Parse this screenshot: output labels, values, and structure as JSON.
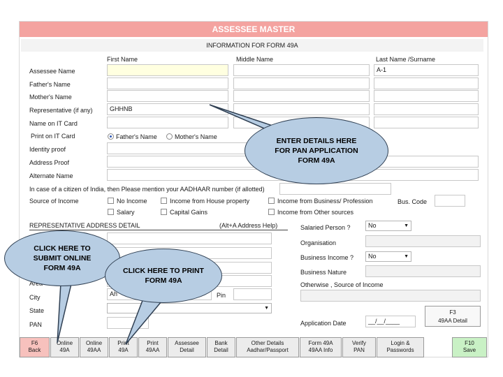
{
  "window": {
    "title": "ASSESSEE MASTER",
    "subtitle": "INFORMATION FOR FORM 49A"
  },
  "name_columns": {
    "first": "First Name",
    "middle": "Middle Name",
    "last": "Last Name /Surname"
  },
  "rows": {
    "assessee_name": {
      "label": "Assessee Name",
      "first": "",
      "middle": "",
      "last": "A-1"
    },
    "fathers_name": {
      "label": "Father's Name"
    },
    "mothers_name": {
      "label": "Mother's Name"
    },
    "representative": {
      "label": "Representative (if any)",
      "first": "GHHNB"
    },
    "name_on_card": {
      "label": "Name on IT Card"
    },
    "print_on_card": {
      "label": "Print on IT Card",
      "option1": "Father's Name",
      "option2": "Mother's Name",
      "selected": "Father's Name"
    },
    "identity_proof": {
      "label": "Identity proof"
    },
    "address_proof": {
      "label": "Address Proof"
    },
    "alternate_name": {
      "label": "Alternate Name"
    }
  },
  "aadhaar_note": "In case of a citizen of India, then Please mention your AADHAAR number (if allotted)",
  "source_income": {
    "label": "Source of Income",
    "options": [
      "No Income",
      "Income from House property",
      "Income from Business/ Profession",
      "Salary",
      "Capital Gains",
      "Income from Other sources"
    ],
    "bus_code_label": "Bus. Code"
  },
  "rep_address": {
    "heading": "REPRESENTATIVE ADDRESS DETAIL",
    "help": "(Alt+A  Address Help)",
    "area_label": "Area",
    "city_label": "City",
    "city_value": "Ah",
    "pin_label": "Pin",
    "state_label": "State",
    "pan_label": "PAN"
  },
  "right_panel": {
    "salaried_label": "Salaried Person ?",
    "salaried_value": "No",
    "organisation_label": "Organisation",
    "business_income_label": "Business Income ?",
    "business_income_value": "No",
    "business_nature_label": "Business Nature",
    "otherwise_label": "Otherwise , Source of Income",
    "application_date_label": "Application Date",
    "application_date_value": "__/__/____",
    "detail_btn_line1": "F3",
    "detail_btn_line2": "49AA Detail"
  },
  "buttons": [
    {
      "line1": "F6",
      "line2": "Back"
    },
    {
      "line1": "Online",
      "line2": "49A"
    },
    {
      "line1": "Online",
      "line2": "49AA"
    },
    {
      "line1": "Print",
      "line2": "49A"
    },
    {
      "line1": "Print",
      "line2": "49AA"
    },
    {
      "line1": "Assessee",
      "line2": "Detail"
    },
    {
      "line1": "Bank",
      "line2": "Detail"
    },
    {
      "line1": "Other Details",
      "line2": "Aadhar/Passport"
    },
    {
      "line1": "Form 49A",
      "line2": "49AA Info"
    },
    {
      "line1": "Verify",
      "line2": "PAN"
    },
    {
      "line1": "Login &",
      "line2": "Passwords"
    },
    {
      "line1": "F10",
      "line2": "Save"
    }
  ],
  "callouts": {
    "enter_details": "ENTER DETAILS HERE FOR PAN APPLICATION FORM 49A",
    "submit": "CLICK HERE TO SUBMIT ONLINE FORM 49A",
    "print": "CLICK HERE TO PRINT FORM 49A"
  },
  "colors": {
    "title_bar": "#f4a3a0",
    "highlight_field": "#ffffe0",
    "callout_fill": "#b7cde3",
    "back_button": "#f7c1bd",
    "save_button": "#c9f1c5"
  }
}
